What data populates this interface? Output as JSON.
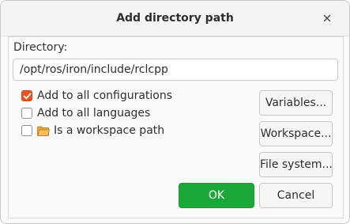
{
  "dialog": {
    "title": "Add directory path",
    "close_icon": "close-icon"
  },
  "directory": {
    "label": "Directory:",
    "value": "/opt/ros/iron/include/rclcpp"
  },
  "options": [
    {
      "label": "Add to all configurations",
      "checked": true
    },
    {
      "label": "Add to all languages",
      "checked": false
    },
    {
      "label": "Is a workspace path",
      "checked": false,
      "icon": "folder-icon"
    }
  ],
  "buttons": {
    "variables": "Variables...",
    "workspace": "Workspace...",
    "file_system": "File system...",
    "ok": "OK",
    "cancel": "Cancel"
  },
  "colors": {
    "accent": "#e95420",
    "ok_button": "#1aa838"
  }
}
